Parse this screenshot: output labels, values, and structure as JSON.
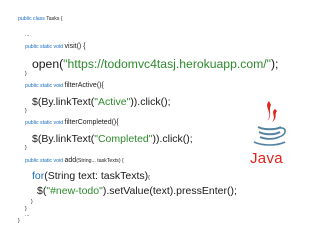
{
  "code": {
    "class_decl": {
      "kw": "public class",
      "name": "Tasks {"
    },
    "ellipsis_1": "...",
    "visit_decl": {
      "kw": "public static void",
      "name": "visit",
      "tail": "() {"
    },
    "open_line": {
      "fn": "open(",
      "str": "\"https://todomvc4tasj.herokuapp.com/\"",
      "end": ");"
    },
    "close_1": "}",
    "filter_active_decl": {
      "kw": "public static void",
      "name": "filterActive",
      "tail": "(){"
    },
    "active_line": {
      "pre": "$(By.linkText(",
      "str": "\"Active\"",
      "end": ")).click();"
    },
    "close_2": "}",
    "filter_completed_decl": {
      "kw": "public static void",
      "name": "filterCompleted",
      "tail": "(){"
    },
    "completed_line": {
      "pre": "$(By.linkText(",
      "str": "\"Completed\"",
      "end": ")).click();"
    },
    "close_3": "}",
    "add_decl": {
      "kw": "public static void",
      "name": "add",
      "tail": "(String... taskTexts) {"
    },
    "for_line": {
      "kw": "for",
      "rest": "(String text: taskTexts)",
      "brace": "{"
    },
    "new_todo_line": {
      "pre": "$(",
      "str": "\"#new-todo\"",
      "end": ").setValue(text).pressEnter();"
    },
    "close_4": "}",
    "close_5": "}",
    "ellipsis_2": "...",
    "close_6": "}"
  },
  "logo": {
    "wordmark": "Java",
    "icon": "java-coffee-cup-icon",
    "brand_red": "#e2231a",
    "brand_blue": "#5382a1"
  },
  "colors": {
    "keyword": "#1a6cc0",
    "string": "#2d8a2d",
    "text": "#1a1a1a"
  }
}
